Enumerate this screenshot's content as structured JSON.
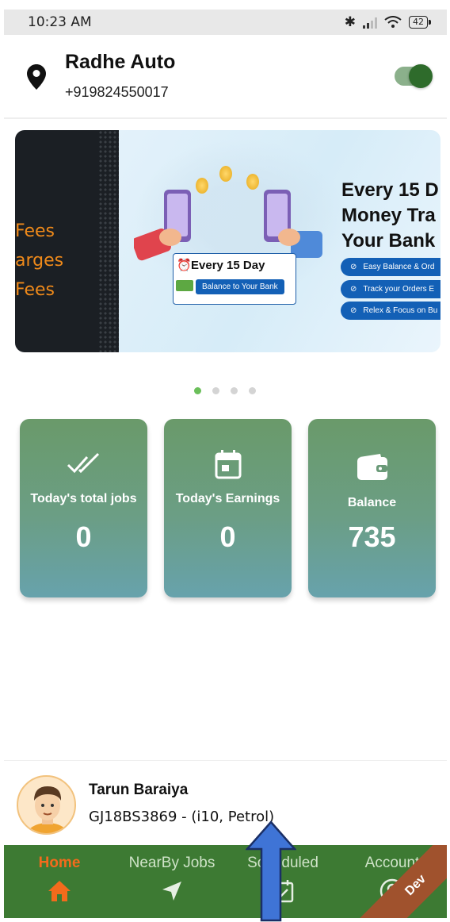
{
  "status_bar": {
    "time": "10:23 AM",
    "battery": "42",
    "bluetooth_icon": "bluetooth-icon",
    "signal_icon": "signal-icon",
    "wifi_icon": "wifi-icon"
  },
  "header": {
    "business_name": "Radhe Auto",
    "phone": "+919824550017",
    "location_icon": "location-pin-icon",
    "online_toggle": true
  },
  "banner": {
    "left_text": [
      "Fees",
      "arges",
      "Fees"
    ],
    "ticket_title": "Every 15 Day",
    "ticket_pill": "Balance to Your Bank",
    "headline": [
      "Every 15 D",
      "Money Tra",
      "Your Bank"
    ],
    "features": [
      "Easy Balance & Ord",
      "Track your Orders E",
      "Relex & Focus on Bu"
    ],
    "indicator_count": 4,
    "active_indicator": 0
  },
  "stats": [
    {
      "label": "Today's total jobs",
      "value": "0",
      "icon": "double-check-icon"
    },
    {
      "label": "Today's Earnings",
      "value": "0",
      "icon": "calendar-icon"
    },
    {
      "label": "Balance",
      "value": "735",
      "icon": "wallet-icon"
    }
  ],
  "driver": {
    "name": "Tarun Baraiya",
    "vehicle": "GJ18BS3869 - (i10, Petrol)"
  },
  "nav": {
    "items": [
      {
        "label": "Home",
        "icon": "home-icon",
        "active": true
      },
      {
        "label": "NearBy Jobs",
        "icon": "navigation-arrow-icon",
        "active": false
      },
      {
        "label": "Scheduled",
        "icon": "calendar-check-icon",
        "active": false
      },
      {
        "label": "Account",
        "icon": "user-circle-icon",
        "active": false
      }
    ],
    "ribbon": "Dev"
  },
  "colors": {
    "brand_green": "#3d7a33",
    "accent_orange": "#f36b1c",
    "card_top": "#6a9a6a",
    "card_bottom": "#67a2ac",
    "banner_blue": "#1360b6"
  }
}
